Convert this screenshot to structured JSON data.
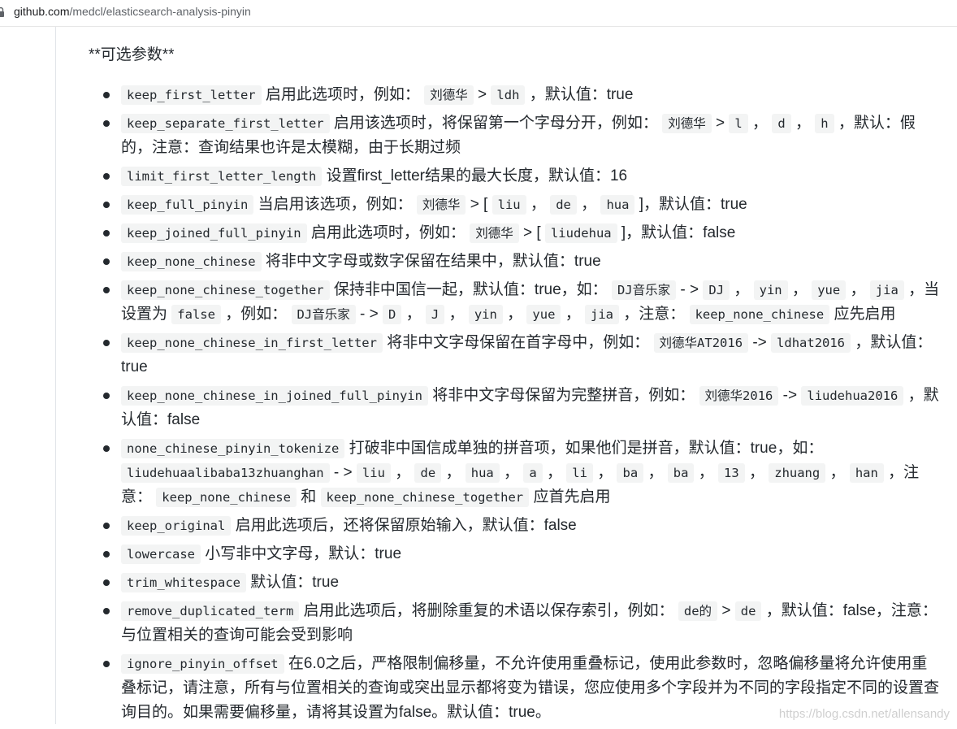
{
  "browser": {
    "url_host": "github.com",
    "url_path": "/medcl/elasticsearch-analysis-pinyin"
  },
  "section_heading": "**可选参数**",
  "options": [
    {
      "parts": [
        {
          "c": "keep_first_letter"
        },
        {
          "t": "启用此选项时，例如："
        },
        {
          "c": "刘德华"
        },
        {
          "t": ">"
        },
        {
          "c": "ldh"
        },
        {
          "t": "，默认值：true"
        }
      ]
    },
    {
      "parts": [
        {
          "c": "keep_separate_first_letter"
        },
        {
          "t": "启用该选项时，将保留第一个字母分开，例如："
        },
        {
          "c": "刘德华"
        },
        {
          "t": ">"
        },
        {
          "c": "l"
        },
        {
          "t": "，"
        },
        {
          "c": "d"
        },
        {
          "t": "，"
        },
        {
          "c": "h"
        },
        {
          "t": "，默认：假的，注意：查询结果也许是太模糊，由于长期过频"
        }
      ]
    },
    {
      "parts": [
        {
          "c": "limit_first_letter_length"
        },
        {
          "t": "设置first_letter结果的最大长度，默认值：16"
        }
      ]
    },
    {
      "parts": [
        {
          "c": "keep_full_pinyin"
        },
        {
          "t": "当启用该选项，例如："
        },
        {
          "c": "刘德华"
        },
        {
          "t": "> ["
        },
        {
          "c": "liu"
        },
        {
          "t": "，"
        },
        {
          "c": "de"
        },
        {
          "t": "，"
        },
        {
          "c": "hua"
        },
        {
          "t": "]，默认值：true"
        }
      ]
    },
    {
      "parts": [
        {
          "c": "keep_joined_full_pinyin"
        },
        {
          "t": "启用此选项时，例如："
        },
        {
          "c": "刘德华"
        },
        {
          "t": "> ["
        },
        {
          "c": "liudehua"
        },
        {
          "t": "]，默认值：false"
        }
      ]
    },
    {
      "parts": [
        {
          "c": "keep_none_chinese"
        },
        {
          "t": "将非中文字母或数字保留在结果中，默认值：true"
        }
      ]
    },
    {
      "parts": [
        {
          "c": "keep_none_chinese_together"
        },
        {
          "t": "保持非中国信一起，默认值：true，如："
        },
        {
          "c": "DJ音乐家"
        },
        {
          "t": "- >"
        },
        {
          "c": "DJ"
        },
        {
          "t": "，"
        },
        {
          "c": "yin"
        },
        {
          "t": "，"
        },
        {
          "c": "yue"
        },
        {
          "t": "，"
        },
        {
          "c": "jia"
        },
        {
          "t": "，当设置为"
        },
        {
          "c": "false"
        },
        {
          "t": "，例如："
        },
        {
          "c": "DJ音乐家"
        },
        {
          "t": "- >"
        },
        {
          "c": "D"
        },
        {
          "t": "，"
        },
        {
          "c": "J"
        },
        {
          "t": "，"
        },
        {
          "c": "yin"
        },
        {
          "t": "，"
        },
        {
          "c": "yue"
        },
        {
          "t": "，"
        },
        {
          "c": "jia"
        },
        {
          "t": "，注意："
        },
        {
          "c": "keep_none_chinese"
        },
        {
          "t": "应先启用"
        }
      ]
    },
    {
      "parts": [
        {
          "c": "keep_none_chinese_in_first_letter"
        },
        {
          "t": "将非中文字母保留在首字母中，例如："
        },
        {
          "c": "刘德华AT2016"
        },
        {
          "t": "->"
        },
        {
          "c": "ldhat2016"
        },
        {
          "t": "，默认值：true"
        }
      ]
    },
    {
      "parts": [
        {
          "c": "keep_none_chinese_in_joined_full_pinyin"
        },
        {
          "t": "将非中文字母保留为完整拼音，例如："
        },
        {
          "c": "刘德华2016"
        },
        {
          "t": "->"
        },
        {
          "c": "liudehua2016"
        },
        {
          "t": "，默认值：false"
        }
      ]
    },
    {
      "parts": [
        {
          "c": "none_chinese_pinyin_tokenize"
        },
        {
          "t": "打破非中国信成单独的拼音项，如果他们是拼音，默认值：true，如："
        },
        {
          "c": "liudehuaalibaba13zhuanghan"
        },
        {
          "t": "- >"
        },
        {
          "c": "liu"
        },
        {
          "t": "，"
        },
        {
          "c": "de"
        },
        {
          "t": "，"
        },
        {
          "c": "hua"
        },
        {
          "t": "，"
        },
        {
          "c": "a"
        },
        {
          "t": "，"
        },
        {
          "c": "li"
        },
        {
          "t": "，"
        },
        {
          "c": "ba"
        },
        {
          "t": "，"
        },
        {
          "c": "ba"
        },
        {
          "t": "，"
        },
        {
          "c": "13"
        },
        {
          "t": "，"
        },
        {
          "c": "zhuang"
        },
        {
          "t": "，"
        },
        {
          "c": "han"
        },
        {
          "t": "，注意："
        },
        {
          "c": "keep_none_chinese"
        },
        {
          "t": "和"
        },
        {
          "c": "keep_none_chinese_together"
        },
        {
          "t": "应首先启用"
        }
      ]
    },
    {
      "parts": [
        {
          "c": "keep_original"
        },
        {
          "t": "启用此选项后，还将保留原始输入，默认值：false"
        }
      ]
    },
    {
      "parts": [
        {
          "c": "lowercase"
        },
        {
          "t": "小写非中文字母，默认：true"
        }
      ]
    },
    {
      "parts": [
        {
          "c": "trim_whitespace"
        },
        {
          "t": "默认值：true"
        }
      ]
    },
    {
      "parts": [
        {
          "c": "remove_duplicated_term"
        },
        {
          "t": "启用此选项后，将删除重复的术语以保存索引，例如："
        },
        {
          "c": "de的"
        },
        {
          "t": ">"
        },
        {
          "c": "de"
        },
        {
          "t": "，默认值：false，注意：与位置相关的查询可能会受到影响"
        }
      ]
    },
    {
      "parts": [
        {
          "c": "ignore_pinyin_offset"
        },
        {
          "t": "在6.0之后，严格限制偏移量，不允许使用重叠标记，使用此参数时，忽略偏移量将允许使用重叠标记，请注意，所有与位置相关的查询或突出显示都将变为错误，您应使用多个字段并为不同的字段指定不同的设置查询目的。如果需要偏移量，请将其设置为false。默认值：true。"
        }
      ]
    }
  ],
  "watermark": "https://blog.csdn.net/allensandy"
}
